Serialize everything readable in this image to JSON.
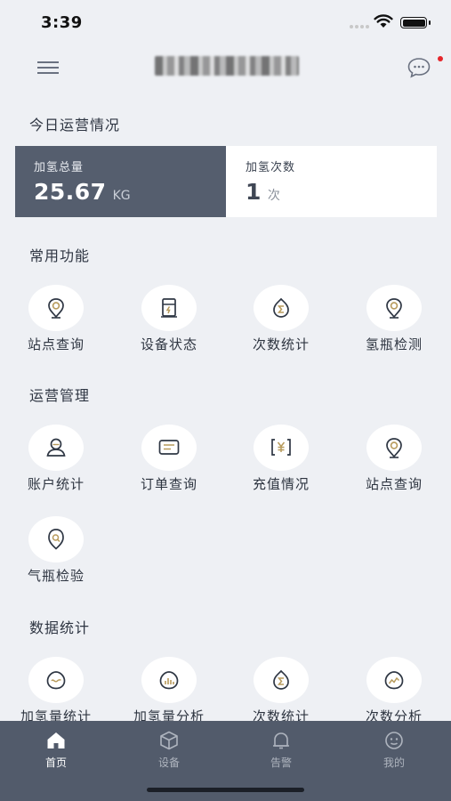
{
  "status_bar": {
    "time": "3:39"
  },
  "header": {
    "title": ""
  },
  "today": {
    "title": "今日运营情况",
    "hydrogen_total": {
      "label": "加氢总量",
      "value": "25.67",
      "unit": "KG"
    },
    "hydrogen_count": {
      "label": "加氢次数",
      "value": "1",
      "unit": "次"
    }
  },
  "common": {
    "title": "常用功能",
    "items": [
      {
        "label": "站点查询",
        "icon": "location-pin-icon"
      },
      {
        "label": "设备状态",
        "icon": "device-icon"
      },
      {
        "label": "次数统计",
        "icon": "count-stats-icon"
      },
      {
        "label": "氢瓶检测",
        "icon": "cylinder-check-icon"
      }
    ]
  },
  "operations": {
    "title": "运营管理",
    "items": [
      {
        "label": "账户统计",
        "icon": "account-icon"
      },
      {
        "label": "订单查询",
        "icon": "order-icon"
      },
      {
        "label": "充值情况",
        "icon": "recharge-icon"
      },
      {
        "label": "站点查询",
        "icon": "location-pin-icon"
      },
      {
        "label": "气瓶检验",
        "icon": "cylinder-inspect-icon"
      }
    ]
  },
  "data_stats": {
    "title": "数据统计",
    "items": [
      {
        "label": "加氢量统计",
        "icon": "volume-stats-icon"
      },
      {
        "label": "加氢量分析",
        "icon": "volume-analysis-icon"
      },
      {
        "label": "次数统计",
        "icon": "count-stats-icon"
      },
      {
        "label": "次数分析",
        "icon": "count-analysis-icon"
      }
    ]
  },
  "tabbar": {
    "items": [
      {
        "label": "首页",
        "icon": "home-icon",
        "active": true
      },
      {
        "label": "设备",
        "icon": "cube-icon",
        "active": false
      },
      {
        "label": "告警",
        "icon": "bell-icon",
        "active": false
      },
      {
        "label": "我的",
        "icon": "profile-icon",
        "active": false
      }
    ]
  },
  "colors": {
    "accent_dark": "#555e6e",
    "tabbar": "#525b6b",
    "icon_gold": "#b79a5b",
    "notification": "#e5262b"
  }
}
